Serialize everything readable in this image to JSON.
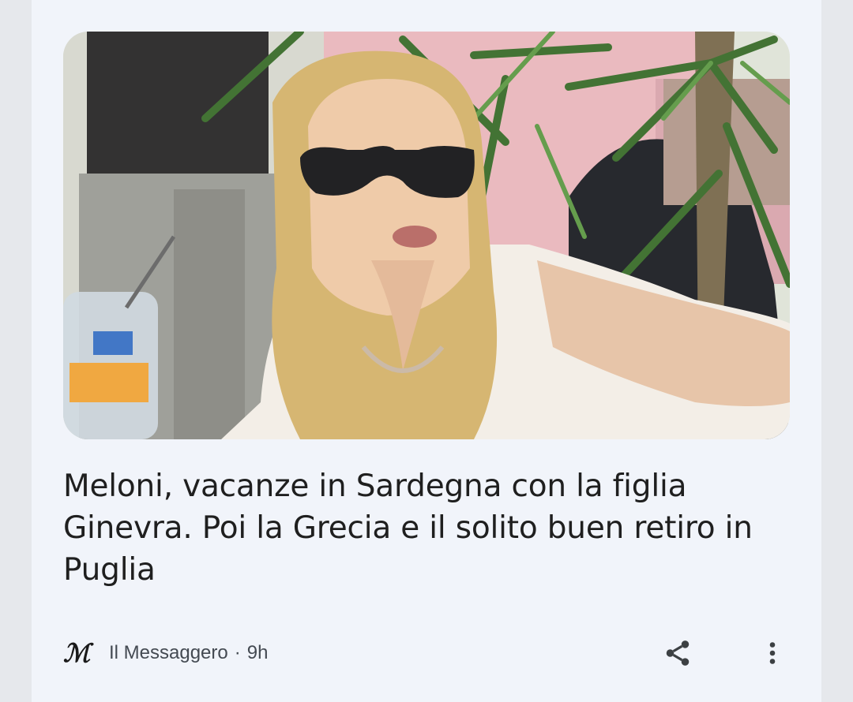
{
  "article": {
    "headline": "Meloni, vacanze in Sardegna con la figlia Ginevra. Poi la Grecia e il solito buen retiro in Puglia",
    "image_alt": "woman-with-sunglasses-photo",
    "source_logo": "ℳ",
    "source": "Il Messaggero",
    "separator": "·",
    "time": "9h"
  },
  "icons": {
    "share": "share-icon",
    "more": "more-vert-icon",
    "logo": "il-messaggero-logo-icon"
  },
  "colors": {
    "card_bg": "#f1f4fa",
    "headline": "#1f1f1f",
    "meta": "#444a52"
  }
}
